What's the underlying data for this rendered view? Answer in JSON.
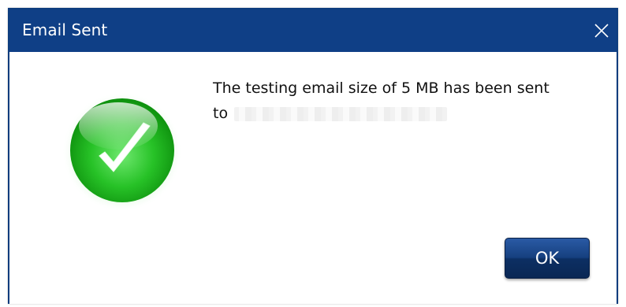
{
  "dialog": {
    "title": "Email Sent",
    "close_icon": "close-icon",
    "icon": "checkmark-success-icon",
    "message_line1": "The testing email size of 5 MB has been sent",
    "message_line2_prefix": "to",
    "ok_label": "OK"
  },
  "colors": {
    "titlebar": "#0f3f86",
    "button": "#16407f",
    "success_green": "#2fc62f"
  }
}
